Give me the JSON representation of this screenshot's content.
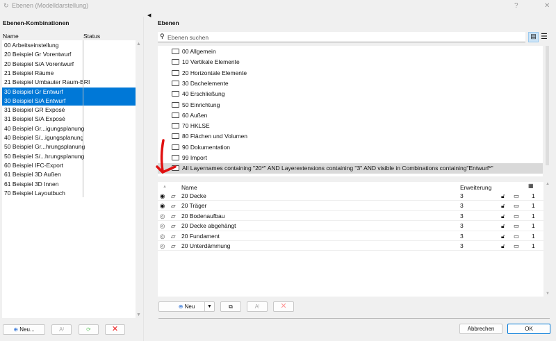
{
  "window": {
    "title": "Ebenen (Modelldarstellung)",
    "help": "?",
    "close": "✕"
  },
  "left": {
    "heading": "Ebenen-Kombinationen",
    "col_name": "Name",
    "col_status": "Status",
    "items": [
      "00 Arbeitseinstellung",
      "20 Beispiel Gr Vorentwurf",
      "20 Beispiel S/A Vorentwurf",
      "21 Beispiel Räume",
      "21 Beispiel Umbauter Raum-BRI",
      "30 Beispiel Gr Entwurf",
      "30 Beispiel S/A Entwurf",
      "31 Beispiel GR Exposé",
      "31 Beispiel S/A Exposé",
      "40 Beispiel Gr...igungsplanung",
      "40 Beispiel S/...igungsplanung",
      "50 Beispiel Gr...hrungsplanung",
      "50 Beispiel S/...hrungsplanung",
      "60 Beispiel IFC-Export",
      "61 Beispiel 3D Außen",
      "61 Beispiel 3D Innen",
      "70 Beispiel Layoutbuch"
    ],
    "selected": [
      5,
      6
    ],
    "new_label": "Neu..."
  },
  "right": {
    "heading": "Ebenen",
    "search_placeholder": "Ebenen suchen",
    "folders": [
      "00 Allgemein",
      "10 Vertikale Elemente",
      "20 Horizontale Elemente",
      "30 Dachelemente",
      "40 Erschließung",
      "50 Einrichtung",
      "60 Außen",
      "70 HKLSE",
      "80 Flächen und Volumen",
      "90 Dokumentation",
      "99 Import",
      "All Layernames containing \"20*\" AND Layerextensions containing \"3\" AND visible in Combinations containing\"Entwurf*\""
    ],
    "table": {
      "col_name": "Name",
      "col_ext": "Erweiterung",
      "rows": [
        {
          "name": "20 Decke",
          "ext": "3",
          "pen": "1",
          "visible": true
        },
        {
          "name": "20 Träger",
          "ext": "3",
          "pen": "1",
          "visible": true
        },
        {
          "name": "20 Bodenaufbau",
          "ext": "3",
          "pen": "1",
          "visible": false
        },
        {
          "name": "20 Decke abgehängt",
          "ext": "3",
          "pen": "1",
          "visible": false
        },
        {
          "name": "20 Fundament",
          "ext": "3",
          "pen": "1",
          "visible": false
        },
        {
          "name": "20 Unterdämmung",
          "ext": "3",
          "pen": "1",
          "visible": false
        }
      ]
    },
    "new_label": "Neu"
  },
  "footer": {
    "cancel": "Abbrechen",
    "ok": "OK"
  },
  "colors": {
    "selection": "#0078d7",
    "annotation": "#e01010"
  }
}
